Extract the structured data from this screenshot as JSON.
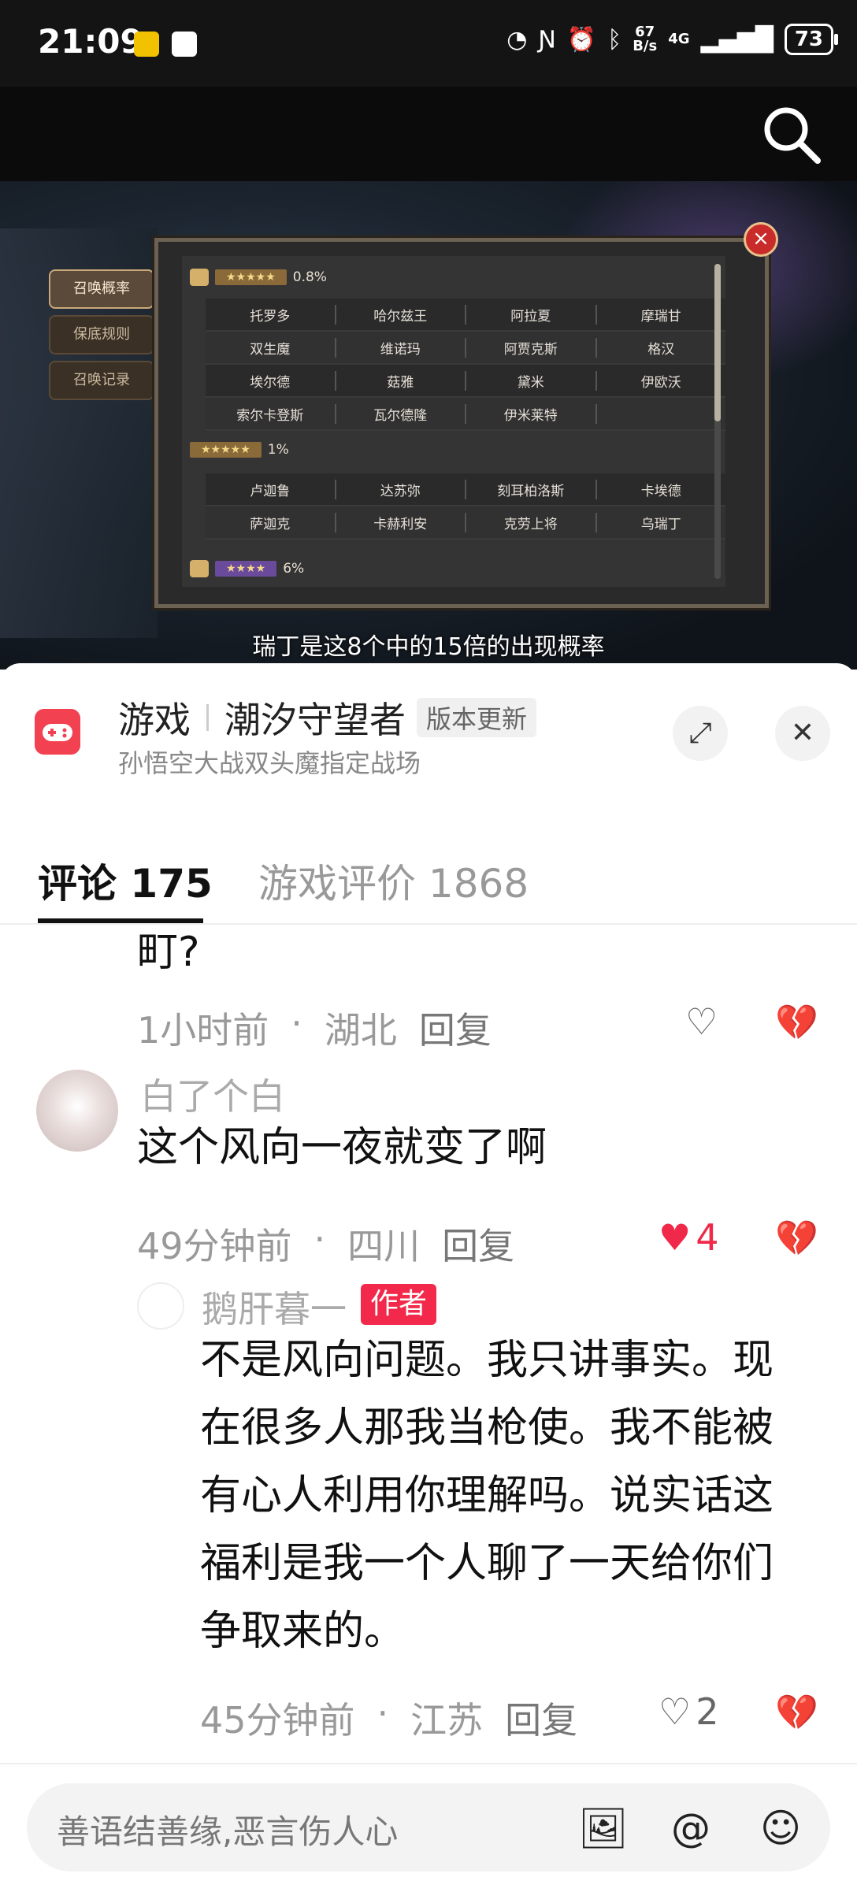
{
  "status": {
    "time": "21:09",
    "net_speed_top": "67",
    "net_speed_bottom": "B/s",
    "signal": "4G",
    "battery": "73"
  },
  "video": {
    "subtitle": "瑞丁是这8个中的15倍的出现概率",
    "tabs": [
      "召唤概率",
      "保底规则",
      "召唤记录"
    ],
    "groups": [
      {
        "stars": "★★★★★",
        "pct": "0.8%",
        "rows": [
          [
            "托罗多",
            "哈尔兹王",
            "阿拉夏",
            "摩瑞甘"
          ],
          [
            "双生魔",
            "维诺玛",
            "阿贾克斯",
            "格汉"
          ],
          [
            "埃尔德",
            "菇雅",
            "黛米",
            "伊欧沃"
          ],
          [
            "索尔卡登斯",
            "瓦尔德隆",
            "伊米莱特",
            ""
          ]
        ]
      },
      {
        "stars": "★★★★★",
        "pct": "1%",
        "rows": [
          [
            "卢迦鲁",
            "达苏弥",
            "刻耳柏洛斯",
            "卡埃德"
          ],
          [
            "萨迦克",
            "卡赫利安",
            "克劳上将",
            "乌瑞丁"
          ]
        ]
      },
      {
        "stars": "★★★★",
        "pct": "6%"
      }
    ]
  },
  "game": {
    "category": "游戏",
    "name": "潮汐守望者",
    "badge": "版本更新",
    "subtitle": "孙悟空大战双头魔指定战场"
  },
  "tabs": {
    "comments": "评论 175",
    "reviews": "游戏评价 1868"
  },
  "comments": [
    {
      "text": "町?",
      "time": "1小时前",
      "location": "湖北",
      "reply": "回复",
      "likes": ""
    },
    {
      "user": "白了个白",
      "text": "这个风向一夜就变了啊",
      "time": "49分钟前",
      "location": "四川",
      "reply": "回复",
      "likes": "4"
    },
    {
      "user": "鹅肝暮一",
      "author_badge": "作者",
      "lines": [
        "不是风向问题。我只讲事实。现",
        "在很多人那我当枪使。我不能被",
        "有心人利用你理解吗。说实话这",
        "福利是我一个人聊了一天给你们",
        "争取来的。"
      ],
      "time": "45分钟前",
      "location": "江苏",
      "reply": "回复",
      "likes": "2"
    }
  ],
  "input": {
    "placeholder": "善语结善缘,恶言伤人心"
  },
  "colors": {
    "accent": "#f2294a",
    "game_icon": "#f24150"
  }
}
